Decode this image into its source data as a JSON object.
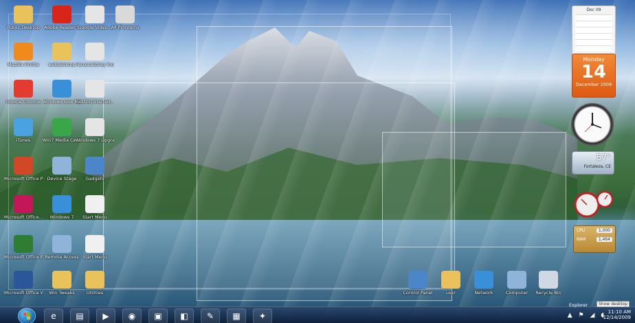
{
  "desktop": {
    "icons_left": [
      {
        "label": "Public Desktop",
        "icon": "folder-icon",
        "color": "#e9c25b"
      },
      {
        "label": "Adobe Reader 9",
        "icon": "pdf-icon",
        "color": "#d9241a"
      },
      {
        "label": "Google Video...",
        "icon": "document-icon",
        "color": "#e5e5e5"
      },
      {
        "label": "All Programs",
        "icon": "programs-icon",
        "color": "#d9d9d9"
      },
      {
        "label": "Mozilla Firefox",
        "icon": "firefox-icon",
        "color": "#f08a1c"
      },
      {
        "label": "webdesktop",
        "icon": "folder-icon",
        "color": "#e9c25b"
      },
      {
        "label": "Personalizing Your PC Win...",
        "icon": "document-icon",
        "color": "#e5e5e5"
      },
      {
        "label": "Google Chrome",
        "icon": "chrome-icon",
        "color": "#e33b2e"
      },
      {
        "label": "Windows Live Mail",
        "icon": "mail-icon",
        "color": "#3a8fd9"
      },
      {
        "label": "Getting Started...",
        "icon": "document-icon",
        "color": "#e5e5e5"
      },
      {
        "label": "iTunes",
        "icon": "music-icon",
        "color": "#4aa3e0"
      },
      {
        "label": "Win7 Media Center",
        "icon": "windows-logo-icon",
        "color": "#3aa64a"
      },
      {
        "label": "Windows 7 Upgrade Advisor",
        "icon": "document-icon",
        "color": "#e5e5e5"
      },
      {
        "label": "Microsoft Office Po...",
        "icon": "powerpoint-icon",
        "color": "#d24726"
      },
      {
        "label": "Device Stage",
        "icon": "device-icon",
        "color": "#8fb3d9"
      },
      {
        "label": "Gadgets",
        "icon": "gadgets-icon",
        "color": "#4a86c8"
      },
      {
        "label": "Microsoft Office...",
        "icon": "office-icon",
        "color": "#c2185b"
      },
      {
        "label": "Windows 7",
        "icon": "windows-logo-icon",
        "color": "#3a8fd9"
      },
      {
        "label": "Start Menu",
        "icon": "start-menu-icon",
        "color": "#f0f0f0"
      },
      {
        "label": "Microsoft Office Excel",
        "icon": "excel-icon",
        "color": "#2e7d32"
      },
      {
        "label": "Remote Access",
        "icon": "network-icon",
        "color": "#8fb3d9"
      },
      {
        "label": "Start Menu",
        "icon": "start-menu-icon",
        "color": "#f0f0f0"
      },
      {
        "label": "Microsoft Office Wor...",
        "icon": "word-icon",
        "color": "#2b579a"
      },
      {
        "label": "Win Tweaks",
        "icon": "folder-icon",
        "color": "#e9c25b"
      },
      {
        "label": "Utilities",
        "icon": "folder-icon",
        "color": "#e9c25b"
      }
    ],
    "icons_bottom": [
      {
        "label": "Control Panel",
        "icon": "control-panel-icon",
        "color": "#4a86c8"
      },
      {
        "label": "user",
        "icon": "user-folder-icon",
        "color": "#e9c25b"
      },
      {
        "label": "Network",
        "icon": "network-globe-icon",
        "color": "#3a8fd9"
      },
      {
        "label": "Computer",
        "icon": "computer-icon",
        "color": "#8fb3d9"
      },
      {
        "label": "Recycle Bin",
        "icon": "recycle-bin-icon",
        "color": "#cfd8e3"
      }
    ]
  },
  "gadgets": {
    "calendar": {
      "month_header": "Dec 09",
      "weekday": "Monday",
      "day": "14",
      "month_year": "December 2009"
    },
    "weather": {
      "temp": "57°",
      "city": "Fortaleza, CE"
    },
    "cpu": {
      "rows": [
        {
          "label": "CPU",
          "value": "1,000"
        },
        {
          "label": "RAM",
          "value": "1,464"
        }
      ]
    }
  },
  "taskbar": {
    "buttons": [
      {
        "icon": "ie-icon",
        "glyph": "e"
      },
      {
        "icon": "explorer-icon",
        "glyph": "▤"
      },
      {
        "icon": "media-player-icon",
        "glyph": "▶"
      },
      {
        "icon": "firefox-icon",
        "glyph": "◉"
      },
      {
        "icon": "window-icon",
        "glyph": "▣"
      },
      {
        "icon": "gadget-icon",
        "glyph": "◧"
      },
      {
        "icon": "paint-icon",
        "glyph": "✎"
      },
      {
        "icon": "presentation-icon",
        "glyph": "▦"
      },
      {
        "icon": "tools-icon",
        "glyph": "✦"
      }
    ],
    "tray": {
      "time": "11:10 AM",
      "date": "12/14/2009",
      "explorer_label": "Explorer",
      "notification": "Show desktop"
    }
  }
}
